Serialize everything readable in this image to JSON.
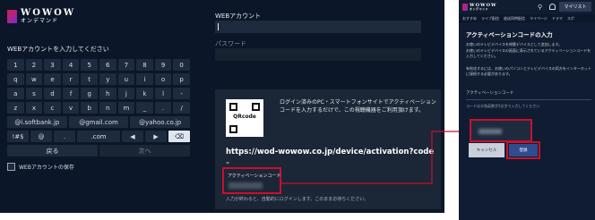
{
  "brand": {
    "name": "WOWOW",
    "subtitle": "オンデマンド"
  },
  "keyboard": {
    "title": "WEBアカウントを入力してください",
    "rows": [
      [
        "1",
        "2",
        "3",
        "4",
        "5",
        "6",
        "7",
        "8",
        "9",
        "0"
      ],
      [
        "q",
        "w",
        "e",
        "r",
        "t",
        "y",
        "u",
        "i",
        "o",
        "p"
      ],
      [
        "a",
        "s",
        "d",
        "f",
        "g",
        "h",
        "j",
        "k",
        "l",
        "-"
      ],
      [
        "z",
        "x",
        "c",
        "v",
        "b",
        "n",
        "m",
        "_",
        ".",
        "/"
      ]
    ],
    "domains": [
      "@i.softbank.jp",
      "@gmail.com",
      "@yahoo.co.jp"
    ],
    "special_row": [
      "!#$",
      "@",
      ".",
      ".com",
      "◀",
      "▶",
      "⌫"
    ],
    "back_label": "戻る",
    "next_label": "次へ",
    "save_label": "WEBアカウントの保存"
  },
  "login": {
    "webid_label": "WEBアカウント",
    "password_label": "パスワード"
  },
  "activation": {
    "qr_label": "QRcode",
    "description": "ログイン済みのPC・スマートフォンサイトでアクティベーションコードを入力するだけで、この視聴機器をご利用頂けます。",
    "url": "https://wod-wowow.co.jp/device/activation?code",
    "url_suffix": "=",
    "code_label": "アクティベーションコード",
    "footer": "入力が終わると、自動的にログインします。このままお待ちください。"
  },
  "phone": {
    "logo": "WOWOW",
    "logo_sub": "オンデマンド",
    "search_icon": "search-icon",
    "mylist_label": "マイリスト",
    "tabs": [
      "おすすめ",
      "ライブ配信",
      "放送同時配信",
      "マイページ",
      "ドラマ",
      "スポ"
    ],
    "title": "アクティベーションコードの入力",
    "para1": "お使いのテレビデバイスを視聴デバイスとして追加します。",
    "para2": "お使いのテレビデバイスの画面に表示されているアクティベーションコードを入力してください。",
    "para3": "有効化するには、お使いのパソコンとテレビデバイスの両方をインターネットに接続する必要があります。",
    "section_label": "アクティベーションコード",
    "note": "コードは半角英数字5文字で入力してください",
    "cancel_label": "キャンセル",
    "register_label": "登録"
  },
  "colors": {
    "highlight": "#c8102e",
    "tv_bg": "#0b1628",
    "register": "#2f4d8e"
  }
}
